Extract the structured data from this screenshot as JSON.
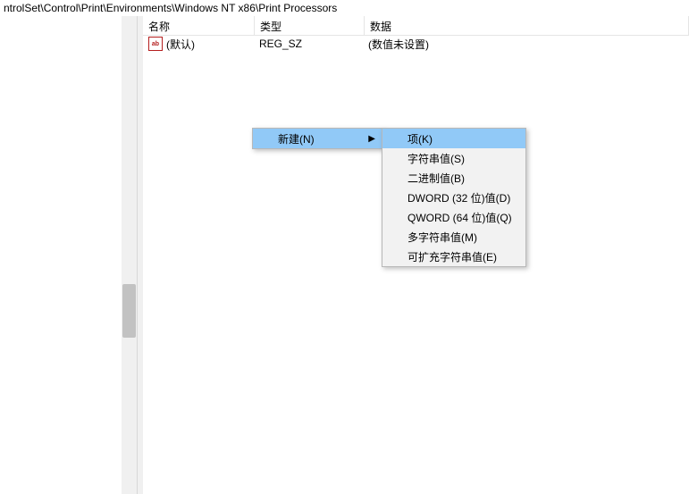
{
  "address_bar": "ntrolSet\\Control\\Print\\Environments\\Windows NT x86\\Print Processors",
  "columns": {
    "name": "名称",
    "type": "类型",
    "data": "数据"
  },
  "row_default": {
    "icon_text": "ab",
    "name": "(默认)",
    "type": "REG_SZ",
    "data": "(数值未设置)"
  },
  "context_menu": {
    "new_label": "新建(N)",
    "submenu": {
      "key": "项(K)",
      "string": "字符串值(S)",
      "binary": "二进制值(B)",
      "dword": "DWORD (32 位)值(D)",
      "qword": "QWORD (64 位)值(Q)",
      "multi": "多字符串值(M)",
      "expand": "可扩充字符串值(E)"
    }
  }
}
